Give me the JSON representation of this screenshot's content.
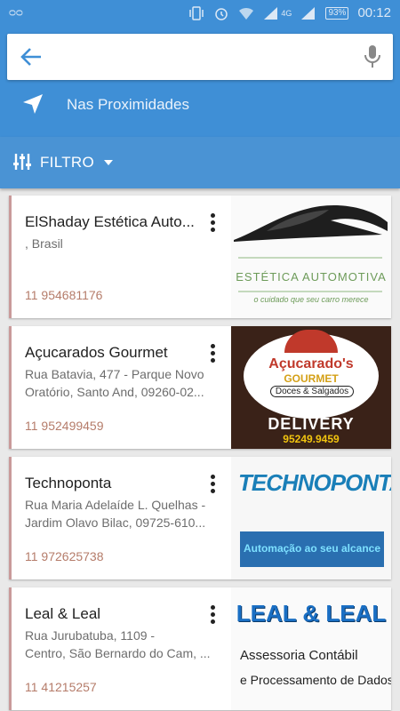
{
  "status_bar": {
    "carrier_icon": "cloud-icon",
    "battery": "93%",
    "time": "00:12",
    "network": "4G"
  },
  "search": {
    "value": "",
    "placeholder": ""
  },
  "nearby": {
    "label": "Nas Proximidades"
  },
  "filter": {
    "label": "FILTRO"
  },
  "colors": {
    "primary": "#3f8fd6",
    "phone": "#b57c6a",
    "card_accent": "#c99a9a"
  },
  "results": [
    {
      "title": "ElShaday Estética Auto...",
      "address_line1": ", Brasil",
      "address_line2": "",
      "phone": "11 954681176",
      "logo": {
        "line1": "ESTÉTICA AUTOMOTIVA",
        "line2": "o cuidado que seu carro merece"
      }
    },
    {
      "title": "Açucarados Gourmet",
      "address_line1": "Rua Batavia, 477 - Parque Novo",
      "address_line2": "Oratório, Santo And, 09260-02...",
      "phone": "11 952499459",
      "logo": {
        "line1": "Açucarado's",
        "line2": "GOURMET",
        "line3": "Doces & Salgados",
        "line4": "DELIVERY",
        "line5": "95249.9459"
      }
    },
    {
      "title": "Technoponta",
      "address_line1": "Rua Maria Adelaíde L. Quelhas -",
      "address_line2": "Jardim Olavo Bilac, 09725-610...",
      "phone": "11 972625738",
      "logo": {
        "line1": "TECHNOPONTA",
        "line2": "Automação ao seu alcance"
      }
    },
    {
      "title": "Leal & Leal",
      "address_line1": "Rua Jurubatuba, 1109 -",
      "address_line2": "Centro, São Bernardo do Cam, ...",
      "phone": "11 41215257",
      "logo": {
        "line1": "LEAL & LEAL",
        "line2": "Assessoria Contábil",
        "line3": "e Processamento de Dados"
      }
    }
  ]
}
